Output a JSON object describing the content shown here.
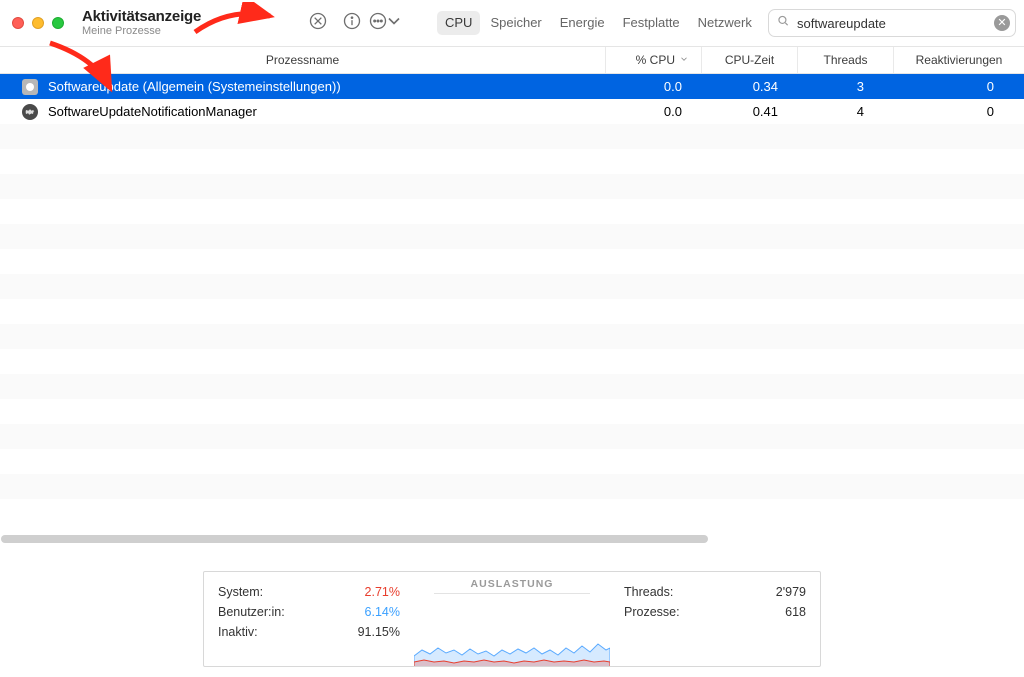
{
  "window": {
    "title": "Aktivitätsanzeige",
    "subtitle": "Meine Prozesse"
  },
  "tabs": {
    "cpu": "CPU",
    "memory": "Speicher",
    "energy": "Energie",
    "disk": "Festplatte",
    "network": "Netzwerk",
    "active": "cpu"
  },
  "search": {
    "value": "softwareupdate"
  },
  "columns": {
    "name": "Prozessname",
    "cpu": "% CPU",
    "time": "CPU-Zeit",
    "threads": "Threads",
    "react": "Reaktivierungen"
  },
  "rows": [
    {
      "icon": "sys",
      "name": "Softwareupdate (Allgemein (Systemeinstellungen))",
      "cpu": "0.0",
      "time": "0.34",
      "threads": "3",
      "react": "0",
      "selected": true
    },
    {
      "icon": "gear",
      "name": "SoftwareUpdateNotificationManager",
      "cpu": "0.0",
      "time": "0.41",
      "threads": "4",
      "react": "0",
      "selected": false
    }
  ],
  "footer": {
    "left": {
      "system_label": "System:",
      "system_value": "2.71%",
      "user_label": "Benutzer:in:",
      "user_value": "6.14%",
      "idle_label": "Inaktiv:",
      "idle_value": "91.15%"
    },
    "mid_title": "AUSLASTUNG",
    "right": {
      "threads_label": "Threads:",
      "threads_value": "2'979",
      "proc_label": "Prozesse:",
      "proc_value": "618"
    }
  }
}
